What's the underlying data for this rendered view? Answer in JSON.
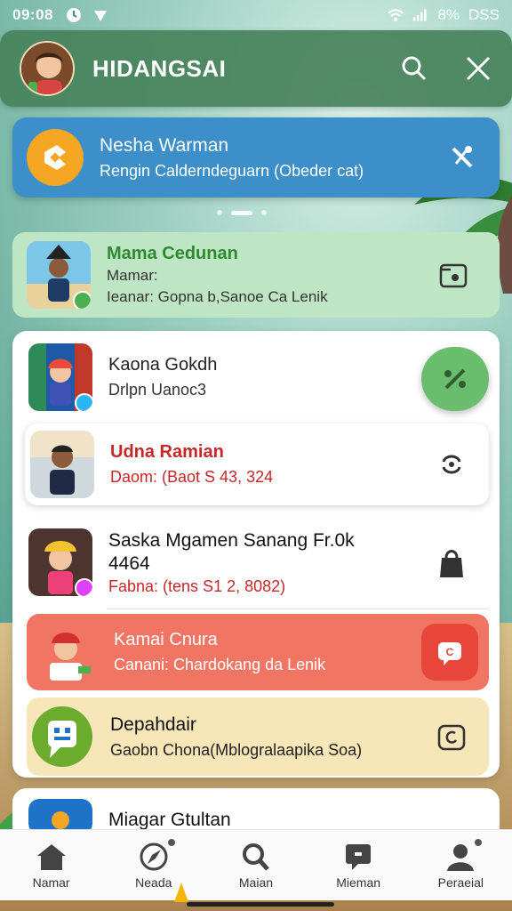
{
  "status_bar": {
    "time": "09:08",
    "battery": "8%",
    "carrier": "DSS"
  },
  "header": {
    "title": "HIDANGSAI",
    "avatar": "child-avatar",
    "search_icon": "search-icon",
    "close_icon": "close-icon"
  },
  "notification": {
    "title": "Nesha Warman",
    "subtitle": "Rengin Calderndeguarn (Obeder cat)",
    "icon": "app-logo-icon",
    "action_icon": "tools-icon"
  },
  "carousel": {
    "pages": 3,
    "active": 1
  },
  "items": [
    {
      "title": "Mama Cedunan",
      "line1": "Mamar:",
      "line2": "Ieanar: Gopna b,Sanoe Ca Lenik",
      "action_icon": "folder-icon"
    },
    {
      "title": "Kaona Gokdh",
      "subtitle": "Drlpn Uanoc3",
      "action_icon": "percent-icon"
    },
    {
      "title": "Udna Ramian",
      "subtitle": "Daom: (Baot S 43, 324",
      "action_icon": "sync-icon"
    },
    {
      "title": "Saska Mgamen Sanang Fr.0k",
      "title2": "4464",
      "subtitle": "Fabna: (tens S1 2, 8082)",
      "action_icon": "bag-icon"
    },
    {
      "title": "Kamai Cnura",
      "subtitle": "Canani: Chardokang da Lenik",
      "action_icon": "chat-icon"
    },
    {
      "title": "Depahdair",
      "subtitle": "Gaobn Chona(Mblogralaapika Soa)",
      "action_icon": "camera-icon"
    },
    {
      "title": "Miagar Gtultan"
    }
  ],
  "bottom_nav": [
    {
      "label": "Namar",
      "icon": "home-icon"
    },
    {
      "label": "Neada",
      "icon": "compass-icon"
    },
    {
      "label": "Maian",
      "icon": "search-icon"
    },
    {
      "label": "Mieman",
      "icon": "message-icon"
    },
    {
      "label": "Peraeial",
      "icon": "profile-icon"
    }
  ],
  "colors": {
    "header": "#46825a",
    "notification": "#3d8fc9",
    "accent_red": "#c62828",
    "accent_green": "#2f8a2f"
  }
}
